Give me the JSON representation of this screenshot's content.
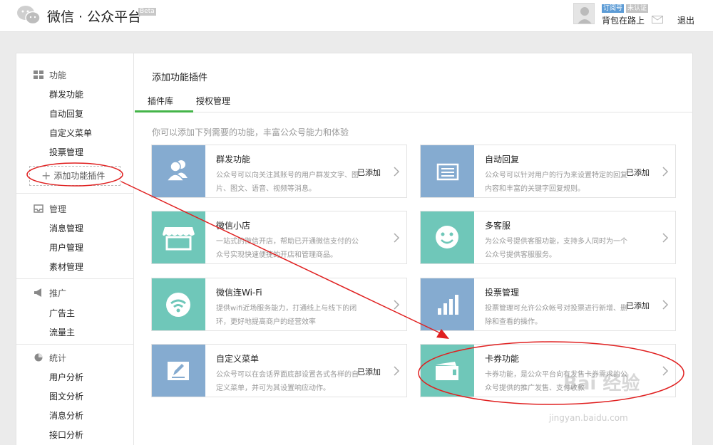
{
  "header": {
    "title": "微信 · 公众平台",
    "beta": "Beta",
    "tag_subscribe": "订阅号",
    "tag_unverified": "未认证",
    "account_name": "背包在路上",
    "logout": "退出"
  },
  "sidebar": {
    "groups": [
      {
        "label": "功能",
        "items": [
          "群发功能",
          "自动回复",
          "自定义菜单",
          "投票管理"
        ]
      },
      {
        "label": "管理",
        "items": [
          "消息管理",
          "用户管理",
          "素材管理"
        ]
      },
      {
        "label": "推广",
        "items": [
          "广告主",
          "流量主"
        ]
      },
      {
        "label": "统计",
        "items": [
          "用户分析",
          "图文分析",
          "消息分析",
          "接口分析"
        ]
      }
    ],
    "add_plugin": "添加功能插件"
  },
  "main": {
    "title": "添加功能插件",
    "tabs": [
      "插件库",
      "授权管理"
    ],
    "hint": "你可以添加下列需要的功能，丰富公众号能力和体验",
    "cards": [
      {
        "name": "群发功能",
        "desc": "公众号可以向关注其账号的用户群发文字、图片、图文、语音、视频等消息。",
        "status": "已添加",
        "icon": "users-icon",
        "color": "#85abd0"
      },
      {
        "name": "自动回复",
        "desc": "公众号可以针对用户的行为来设置特定的回复内容和丰富的关键字回复规则。",
        "status": "已添加",
        "icon": "reply-icon",
        "color": "#85abd0"
      },
      {
        "name": "微信小店",
        "desc": "一站式的微信开店，帮助已开通微信支付的公众号实现快速便捷的开店和管理商品。",
        "status": "",
        "icon": "shop-icon",
        "color": "#6fc7b9"
      },
      {
        "name": "多客服",
        "desc": "为公众号提供客服功能，支持多人同时为一个公众号提供客服服务。",
        "status": "",
        "icon": "smile-icon",
        "color": "#6fc7b9"
      },
      {
        "name": "微信连Wi-Fi",
        "desc": "提供wifi近场服务能力，打通线上与线下的闭环，更好地提高商户的经营效率",
        "status": "",
        "icon": "wifi-icon",
        "color": "#6fc7b9"
      },
      {
        "name": "投票管理",
        "desc": "投票管理可允许公众帐号对投票进行新增、删除和查看的操作。",
        "status": "已添加",
        "icon": "chart-bars-icon",
        "color": "#85abd0"
      },
      {
        "name": "自定义菜单",
        "desc": "公众号可以在会话界面底部设置各式各样的自定义菜单，并可为其设置响应动作。",
        "status": "已添加",
        "icon": "edit-icon",
        "color": "#85abd0"
      },
      {
        "name": "卡券功能",
        "desc": "卡券功能，是公众平台向有发售卡券需求的公众号提供的推广发售、支付收款",
        "status": "",
        "icon": "card-icon",
        "color": "#6fc7b9"
      }
    ]
  },
  "watermark": {
    "logo": "Bai 经验",
    "url": "jingyan.baidu.com"
  },
  "colors": {
    "accent": "#44b549",
    "annotation": "#e02020"
  }
}
